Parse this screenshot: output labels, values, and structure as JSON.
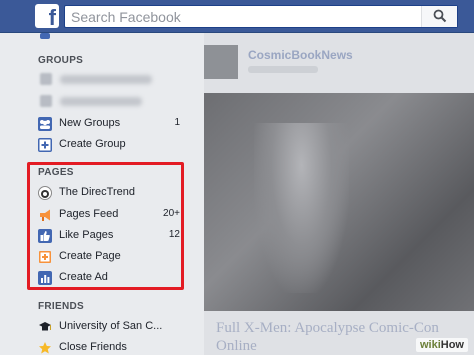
{
  "header": {
    "logo": "f",
    "search_placeholder": "Search Facebook"
  },
  "sidebar": {
    "groups_title": "GROUPS",
    "group_items": [
      {
        "label": "New Groups",
        "count": "1",
        "icon": "groups-icon"
      },
      {
        "label": "Create Group",
        "icon": "plus-icon"
      }
    ],
    "pages_title": "PAGES",
    "page_items": [
      {
        "label": "The DirecTrend",
        "icon": "page-avatar-icon"
      },
      {
        "label": "Pages Feed",
        "count": "20+",
        "icon": "megaphone-icon"
      },
      {
        "label": "Like Pages",
        "count": "12",
        "icon": "thumbs-up-icon"
      },
      {
        "label": "Create Page",
        "icon": "plus-icon"
      },
      {
        "label": "Create Ad",
        "icon": "bar-chart-icon"
      }
    ],
    "friends_title": "FRIENDS",
    "friend_items": [
      {
        "label": "University of San C...",
        "icon": "graduation-cap-icon"
      },
      {
        "label": "Close Friends",
        "icon": "star-icon"
      }
    ]
  },
  "feed": {
    "post_page_name": "CosmicBookNews",
    "post_title": "Full X-Men: Apocalypse Comic-Con Online"
  },
  "watermark": {
    "part1": "wiki",
    "part2": "How"
  },
  "colors": {
    "brand": "#3b5998",
    "highlight": "#e31b23"
  }
}
